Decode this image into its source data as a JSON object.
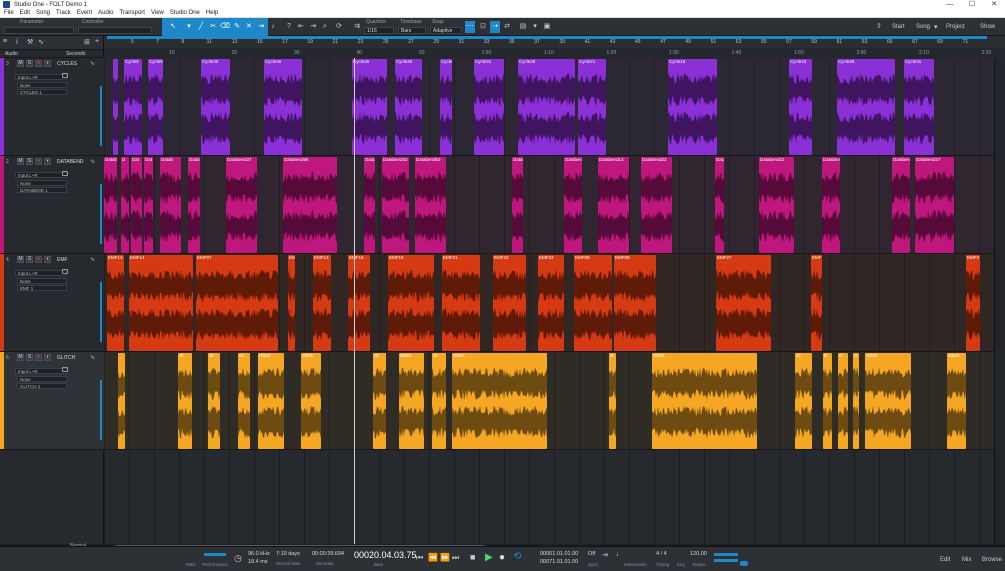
{
  "window": {
    "title": "Studio One - FOLT Demo 1",
    "controls": [
      "—",
      "☐",
      "✕"
    ]
  },
  "menu": [
    "File",
    "Edit",
    "Song",
    "Track",
    "Event",
    "Audio",
    "Transport",
    "View",
    "Studio One",
    "Help"
  ],
  "toolbar": {
    "parameter_label": "Parameter",
    "controller_label": "Controller",
    "quantize_label": "Quantize",
    "quantize_value": "1/16",
    "timebase_label": "Timebase",
    "timebase_value": "Bars",
    "snap_label": "Snap",
    "snap_value": "Adaptive",
    "start_label": "Start",
    "song_label": "Song",
    "project_label": "Project",
    "show_label": "Show"
  },
  "track_header": {
    "mode_value": "Audio",
    "display_value": "Seconds"
  },
  "ruler": {
    "bars": [
      "5",
      "7",
      "9",
      "11",
      "13",
      "15",
      "17",
      "19",
      "21",
      "23",
      "25",
      "27",
      "29",
      "31",
      "33",
      "35",
      "37",
      "39",
      "41",
      "43",
      "45",
      "47",
      "49",
      "51",
      "53",
      "55",
      "57",
      "59",
      "61",
      "63",
      "65",
      "67",
      "69",
      "71"
    ],
    "seconds": [
      "10",
      "20",
      "30",
      "40",
      "50",
      "1:00",
      "1:10",
      "1:20",
      "1:30",
      "1:40",
      "1:50",
      "2:00",
      "2:10",
      "2:20"
    ]
  },
  "tracks": [
    {
      "num": "3",
      "name": "CYCLES",
      "input": "Input L+R",
      "route": "None",
      "output": "CYCLES 1",
      "color": "#8b2fd6",
      "lane_bg": "#2b2833"
    },
    {
      "num": "2",
      "name": "DATABEND",
      "input": "Input L+R",
      "route": "None",
      "output": "DATABEND 1",
      "color": "#c0177e",
      "lane_bg": "#2f2630"
    },
    {
      "num": "4",
      "name": "EMF",
      "input": "Input L+R",
      "route": "None",
      "output": "EMF 1",
      "color": "#d63a12",
      "lane_bg": "#302724"
    },
    {
      "num": "5",
      "name": "GLITCH",
      "input": "Input L+R",
      "route": "None",
      "output": "GLITCH 1",
      "color": "#f5a623",
      "lane_bg": "#2f2c25"
    }
  ],
  "clips": [
    {
      "track": 0,
      "start": 9,
      "end": 14,
      "name": ""
    },
    {
      "track": 0,
      "start": 20,
      "end": 38,
      "name": "Cycle5"
    },
    {
      "track": 0,
      "start": 44,
      "end": 59,
      "name": "Cycle5"
    },
    {
      "track": 0,
      "start": 97,
      "end": 126,
      "name": "Cycle30"
    },
    {
      "track": 0,
      "start": 160,
      "end": 198,
      "name": "Cycle46"
    },
    {
      "track": 0,
      "start": 248,
      "end": 283,
      "name": "Cycle45"
    },
    {
      "track": 0,
      "start": 291,
      "end": 318,
      "name": "Cycle40"
    },
    {
      "track": 0,
      "start": 336,
      "end": 348,
      "name": "Cycle"
    },
    {
      "track": 0,
      "start": 370,
      "end": 400,
      "name": "Cycle31"
    },
    {
      "track": 0,
      "start": 414,
      "end": 471,
      "name": "Cycle28"
    },
    {
      "track": 0,
      "start": 474,
      "end": 502,
      "name": "Cycle21"
    },
    {
      "track": 0,
      "start": 564,
      "end": 613,
      "name": "Cycle18"
    },
    {
      "track": 0,
      "start": 685,
      "end": 708,
      "name": "Cycle23"
    },
    {
      "track": 0,
      "start": 733,
      "end": 791,
      "name": "Cycle28"
    },
    {
      "track": 0,
      "start": 800,
      "end": 830,
      "name": "Cycle31"
    },
    {
      "track": 1,
      "start": 0,
      "end": 13,
      "name": "Datab"
    },
    {
      "track": 1,
      "start": 17,
      "end": 25,
      "name": "D"
    },
    {
      "track": 1,
      "start": 27,
      "end": 38,
      "name": "Dat"
    },
    {
      "track": 1,
      "start": 40,
      "end": 49,
      "name": "Dat"
    },
    {
      "track": 1,
      "start": 56,
      "end": 77,
      "name": "Datab"
    },
    {
      "track": 1,
      "start": 84,
      "end": 96,
      "name": "Datal"
    },
    {
      "track": 1,
      "start": 122,
      "end": 153,
      "name": "Databend37"
    },
    {
      "track": 1,
      "start": 179,
      "end": 233,
      "name": "Databend56"
    },
    {
      "track": 1,
      "start": 260,
      "end": 271,
      "name": "Data"
    },
    {
      "track": 1,
      "start": 278,
      "end": 305,
      "name": "Databend42"
    },
    {
      "track": 1,
      "start": 311,
      "end": 342,
      "name": "Databend53"
    },
    {
      "track": 1,
      "start": 408,
      "end": 419,
      "name": "Datal"
    },
    {
      "track": 1,
      "start": 460,
      "end": 478,
      "name": "Databen"
    },
    {
      "track": 1,
      "start": 494,
      "end": 525,
      "name": "Databend13"
    },
    {
      "track": 1,
      "start": 537,
      "end": 568,
      "name": "Databend22"
    },
    {
      "track": 1,
      "start": 611,
      "end": 620,
      "name": "Datal"
    },
    {
      "track": 1,
      "start": 655,
      "end": 690,
      "name": "Databend21"
    },
    {
      "track": 1,
      "start": 718,
      "end": 736,
      "name": "Databen"
    },
    {
      "track": 1,
      "start": 788,
      "end": 806,
      "name": "Databen"
    },
    {
      "track": 1,
      "start": 811,
      "end": 850,
      "name": "Databend27"
    },
    {
      "track": 2,
      "start": 3,
      "end": 20,
      "name": "EMF13"
    },
    {
      "track": 2,
      "start": 25,
      "end": 89,
      "name": "EMF14"
    },
    {
      "track": 2,
      "start": 92,
      "end": 174,
      "name": "EMF07"
    },
    {
      "track": 2,
      "start": 184,
      "end": 191,
      "name": "EM"
    },
    {
      "track": 2,
      "start": 209,
      "end": 227,
      "name": "EMF13"
    },
    {
      "track": 2,
      "start": 244,
      "end": 266,
      "name": "EMF16"
    },
    {
      "track": 2,
      "start": 284,
      "end": 330,
      "name": "EMF19"
    },
    {
      "track": 2,
      "start": 338,
      "end": 376,
      "name": "EMF21"
    },
    {
      "track": 2,
      "start": 389,
      "end": 422,
      "name": "EMF23"
    },
    {
      "track": 2,
      "start": 434,
      "end": 460,
      "name": "EMF23"
    },
    {
      "track": 2,
      "start": 470,
      "end": 508,
      "name": "EMF08"
    },
    {
      "track": 2,
      "start": 510,
      "end": 552,
      "name": "EMF08"
    },
    {
      "track": 2,
      "start": 612,
      "end": 667,
      "name": "EMF27"
    },
    {
      "track": 2,
      "start": 707,
      "end": 718,
      "name": "EMF"
    },
    {
      "track": 2,
      "start": 862,
      "end": 876,
      "name": "EMF2"
    },
    {
      "track": 3,
      "start": 14,
      "end": 21,
      "name": ""
    },
    {
      "track": 3,
      "start": 74,
      "end": 88,
      "name": "Gl"
    },
    {
      "track": 3,
      "start": 104,
      "end": 116,
      "name": "Gl"
    },
    {
      "track": 3,
      "start": 134,
      "end": 146,
      "name": "Gl"
    },
    {
      "track": 3,
      "start": 154,
      "end": 180,
      "name": "Glitch"
    },
    {
      "track": 3,
      "start": 197,
      "end": 217,
      "name": "Glitch"
    },
    {
      "track": 3,
      "start": 269,
      "end": 282,
      "name": "Gl"
    },
    {
      "track": 3,
      "start": 295,
      "end": 320,
      "name": "Glitch"
    },
    {
      "track": 3,
      "start": 328,
      "end": 342,
      "name": "Gl"
    },
    {
      "track": 3,
      "start": 348,
      "end": 443,
      "name": "Glitch"
    },
    {
      "track": 3,
      "start": 505,
      "end": 512,
      "name": "G"
    },
    {
      "track": 3,
      "start": 548,
      "end": 653,
      "name": "Glitch"
    },
    {
      "track": 3,
      "start": 691,
      "end": 708,
      "name": "Gl"
    },
    {
      "track": 3,
      "start": 719,
      "end": 728,
      "name": "G"
    },
    {
      "track": 3,
      "start": 734,
      "end": 744,
      "name": "G"
    },
    {
      "track": 3,
      "start": 749,
      "end": 755,
      "name": "G"
    },
    {
      "track": 3,
      "start": 761,
      "end": 807,
      "name": "Glitch"
    },
    {
      "track": 3,
      "start": 843,
      "end": 862,
      "name": "Glitch"
    }
  ],
  "status": {
    "midi_label": "MIDI",
    "performance_label": "Performance",
    "sample_rate": "96.0 kHz",
    "latency": "18.4 ms",
    "record_max": "7:19 days",
    "record_max_label": "Record Max",
    "seconds_value": "00:00:39.694",
    "seconds_label": "Seconds",
    "bars_value": "00020.04.03.75",
    "bars_label": "Bars",
    "loop_start": "00001.01.01.00",
    "loop_end": "00071.01.01.00",
    "sync_value": "Off",
    "sync_label": "Sync",
    "metronome_label": "Metronome",
    "timing_value": "4 / 4",
    "timing_label": "Timing",
    "key_label": "Key",
    "tempo_value": "120.00",
    "tempo_label": "Tempo",
    "edit_label": "Edit",
    "mix_label": "Mix",
    "browse_label": "Browse",
    "zoom_mode": "Normal"
  }
}
